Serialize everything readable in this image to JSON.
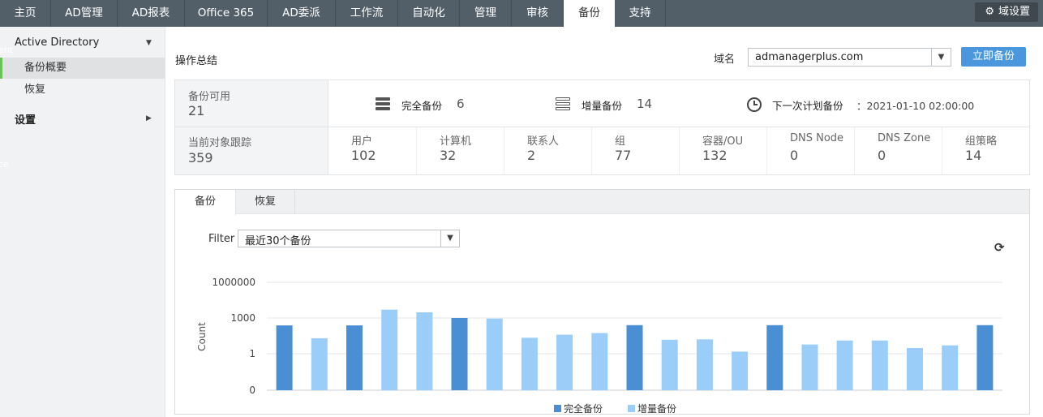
{
  "nav": {
    "tabs": [
      {
        "label": "主页"
      },
      {
        "label": "AD管理"
      },
      {
        "label": "AD报表"
      },
      {
        "label": "Office 365"
      },
      {
        "label": "AD委派"
      },
      {
        "label": "工作流"
      },
      {
        "label": "自动化"
      },
      {
        "label": "管理"
      },
      {
        "label": "审核"
      },
      {
        "label": "备份"
      },
      {
        "label": "支持"
      }
    ],
    "active_tab": "备份",
    "domain_settings_label": "域设置"
  },
  "sidebar": {
    "group1_label": "Active Directory",
    "items": [
      {
        "label": "备份概要",
        "active": true
      },
      {
        "label": "恢复",
        "active": false
      }
    ],
    "group2_label": "设置",
    "ghost1": "ent",
    "ghost2": "ce"
  },
  "header": {
    "title": "操作总结",
    "domain_label": "域名",
    "domain_value": "admanagerplus.com",
    "backup_now_label": "立即备份"
  },
  "summary": {
    "backups_available_label": "备份可用",
    "backups_available_value": "21",
    "objects_tracked_label": "当前对象跟踪",
    "objects_tracked_value": "359",
    "full_backup_label": "完全备份",
    "full_backup_value": "6",
    "incremental_backup_label": "增量备份",
    "incremental_backup_value": "14",
    "next_backup_label": "下一次计划备份",
    "next_backup_value": "：2021-01-10 02:00:00",
    "objects": [
      {
        "label": "用户",
        "value": "102"
      },
      {
        "label": "计算机",
        "value": "32"
      },
      {
        "label": "联系人",
        "value": "2"
      },
      {
        "label": "组",
        "value": "77"
      },
      {
        "label": "容器/OU",
        "value": "132"
      },
      {
        "label": "DNS Node",
        "value": "0"
      },
      {
        "label": "DNS Zone",
        "value": "0"
      },
      {
        "label": "组策略",
        "value": "14"
      }
    ]
  },
  "panel": {
    "tabs": [
      {
        "label": "备份"
      },
      {
        "label": "恢复"
      }
    ],
    "filter_label": "Filter",
    "filter_value": "最近30个备份"
  },
  "colors": {
    "full": "#4a8fd3",
    "incremental": "#9bcdf9",
    "accent": "#4a97dd",
    "nav": "#535f68"
  },
  "chart_data": {
    "type": "bar",
    "scale": "log",
    "ylabel": "Count",
    "yticks": [
      "1000000",
      "1000",
      "1",
      "0"
    ],
    "series_names": [
      "完全备份",
      "增量备份"
    ],
    "bars": [
      {
        "series": "full",
        "value": 240
      },
      {
        "series": "incremental",
        "value": 20
      },
      {
        "series": "full",
        "value": 240
      },
      {
        "series": "incremental",
        "value": 5000
      },
      {
        "series": "incremental",
        "value": 3000
      },
      {
        "series": "full",
        "value": 1000
      },
      {
        "series": "incremental",
        "value": 900
      },
      {
        "series": "incremental",
        "value": 22
      },
      {
        "series": "incremental",
        "value": 40
      },
      {
        "series": "incremental",
        "value": 55
      },
      {
        "series": "full",
        "value": 250
      },
      {
        "series": "incremental",
        "value": 15
      },
      {
        "series": "incremental",
        "value": 16
      },
      {
        "series": "incremental",
        "value": 1.5
      },
      {
        "series": "full",
        "value": 250
      },
      {
        "series": "incremental",
        "value": 6
      },
      {
        "series": "incremental",
        "value": 13
      },
      {
        "series": "incremental",
        "value": 13
      },
      {
        "series": "incremental",
        "value": 3
      },
      {
        "series": "incremental",
        "value": 5
      },
      {
        "series": "full",
        "value": 250
      }
    ]
  }
}
